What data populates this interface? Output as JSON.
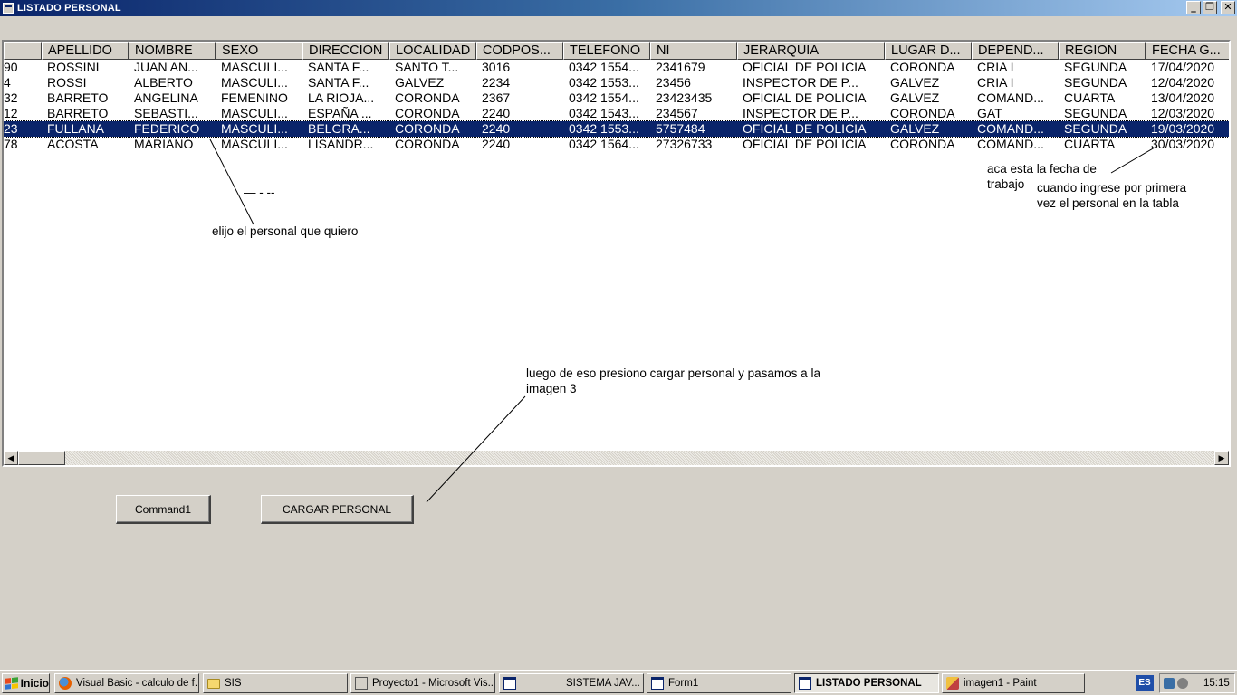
{
  "window": {
    "title": "LISTADO PERSONAL",
    "minimize_glyph": "_",
    "restore_glyph": "❐",
    "close_glyph": "✕"
  },
  "grid": {
    "columns": [
      "",
      "APELLIDO",
      "NOMBRE",
      "SEXO",
      "DIRECCION",
      "LOCALIDAD",
      "CODPOS...",
      "TELEFONO",
      "NI",
      "JERARQUIA",
      "LUGAR D...",
      "DEPEND...",
      "REGION",
      "FECHA G..."
    ],
    "rows": [
      [
        "90",
        "ROSSINI",
        "JUAN AN...",
        "MASCULI...",
        "SANTA F...",
        "SANTO T...",
        "3016",
        "0342 1554...",
        "2341679",
        "OFICIAL DE POLICIA",
        "CORONDA",
        "CRIA I",
        "SEGUNDA",
        "17/04/2020"
      ],
      [
        "4",
        "ROSSI",
        "ALBERTO",
        "MASCULI...",
        "SANTA F...",
        "GALVEZ",
        "2234",
        "0342 1553...",
        "23456",
        "INSPECTOR DE P...",
        "GALVEZ",
        "CRIA I",
        "SEGUNDA",
        "12/04/2020"
      ],
      [
        "32",
        "BARRETO",
        "ANGELINA",
        "FEMENINO",
        "LA RIOJA...",
        "CORONDA",
        "2367",
        "0342 1554...",
        "23423435",
        "OFICIAL DE POLICIA",
        "GALVEZ",
        "COMAND...",
        "CUARTA",
        "13/04/2020"
      ],
      [
        "12",
        "BARRETO",
        "SEBASTI...",
        "MASCULI...",
        "ESPAÑA ...",
        "CORONDA",
        "2240",
        "0342 1543...",
        "234567",
        "INSPECTOR DE P...",
        "CORONDA",
        "GAT",
        "SEGUNDA",
        "12/03/2020"
      ],
      [
        "23",
        "FULLANA",
        "FEDERICO",
        "MASCULI...",
        "BELGRA...",
        "CORONDA",
        "2240",
        "0342 1553...",
        "5757484",
        "OFICIAL DE POLICIA",
        "GALVEZ",
        "COMAND...",
        "SEGUNDA",
        "19/03/2020"
      ],
      [
        "78",
        "ACOSTA",
        "MARIANO",
        "MASCULI...",
        "LISANDR...",
        "CORONDA",
        "2240",
        "0342 1564...",
        "27326733",
        "OFICIAL DE POLICIA",
        "CORONDA",
        "COMAND...",
        "CUARTA",
        "30/03/2020"
      ]
    ],
    "selected_row": 4,
    "scroll_left_glyph": "◀",
    "scroll_right_glyph": "▶"
  },
  "annotations": {
    "pick": "elijo el personal que quiero",
    "dash": "— - --",
    "date_line1": "aca esta la fecha de",
    "date_line2": "trabajo",
    "date_line3": "cuando ingrese por primera",
    "date_line4": "vez el personal en la tabla",
    "load_line1": "luego de eso presiono cargar personal y pasamos a la",
    "load_line2": "imagen 3"
  },
  "buttons": {
    "command1": "Command1",
    "cargar": "CARGAR PERSONAL"
  },
  "taskbar": {
    "start": "Inicio",
    "items": [
      {
        "label": "Visual Basic - calculo de f...",
        "icon": "firefox-icon"
      },
      {
        "label": "SIS",
        "icon": "folder-icon"
      },
      {
        "label": "Proyecto1 - Microsoft Vis...",
        "icon": "vb-icon"
      },
      {
        "label": "SISTEMA JAV...",
        "icon": "form-icon"
      },
      {
        "label": "Form1",
        "icon": "form-icon"
      },
      {
        "label": "LISTADO PERSONAL",
        "icon": "form-icon"
      },
      {
        "label": "imagen1 - Paint",
        "icon": "paint-icon"
      }
    ],
    "language": "ES",
    "clock": "15:15"
  },
  "colors": {
    "selection": "#0a246a",
    "face": "#d4d0c8",
    "title_start": "#0a246a",
    "title_end": "#a6caf0"
  }
}
